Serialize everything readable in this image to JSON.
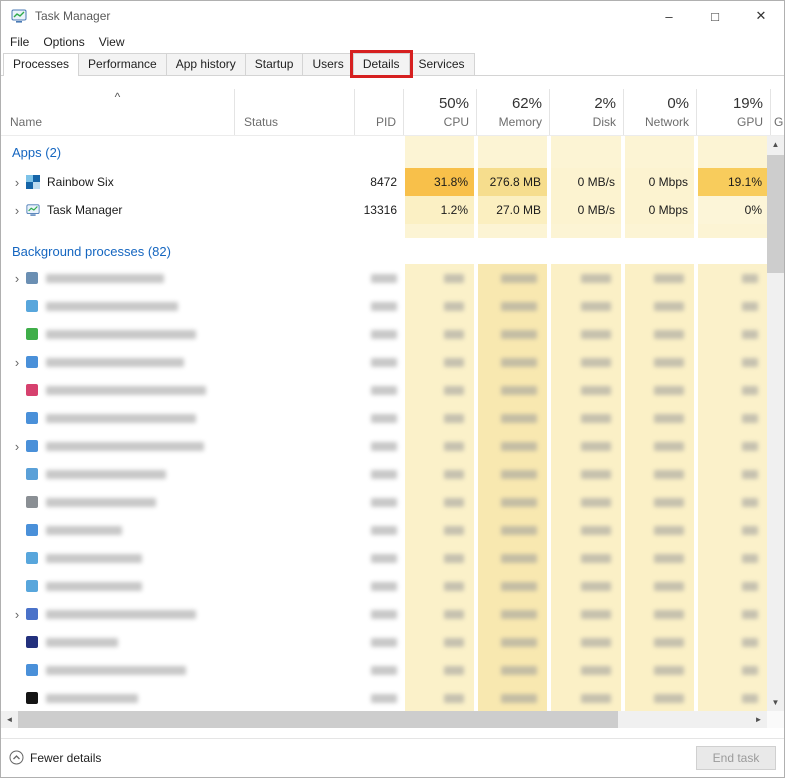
{
  "window": {
    "title": "Task Manager"
  },
  "icons": {
    "minimize": "–",
    "maximize": "□",
    "close": "✕",
    "up": "▲",
    "down": "▼",
    "left": "◄",
    "right": "►",
    "expander": "›",
    "sort_asc": "^"
  },
  "menu": {
    "items": [
      "File",
      "Options",
      "View"
    ]
  },
  "tabs": {
    "items": [
      {
        "label": "Processes",
        "active": true,
        "highlighted": false
      },
      {
        "label": "Performance",
        "active": false,
        "highlighted": false
      },
      {
        "label": "App history",
        "active": false,
        "highlighted": false
      },
      {
        "label": "Startup",
        "active": false,
        "highlighted": false
      },
      {
        "label": "Users",
        "active": false,
        "highlighted": false
      },
      {
        "label": "Details",
        "active": false,
        "highlighted": true
      },
      {
        "label": "Services",
        "active": false,
        "highlighted": false
      }
    ]
  },
  "columns": {
    "name": {
      "label": "Name"
    },
    "status": {
      "label": "Status"
    },
    "pid": {
      "label": "PID"
    },
    "metrics": [
      {
        "label": "CPU",
        "total": "50%"
      },
      {
        "label": "Memory",
        "total": "62%"
      },
      {
        "label": "Disk",
        "total": "2%"
      },
      {
        "label": "Network",
        "total": "0%"
      },
      {
        "label": "GPU",
        "total": "19%"
      }
    ],
    "cut": {
      "label": "G"
    }
  },
  "groups": {
    "apps": "Apps (2)",
    "background": "Background processes (82)"
  },
  "processes": [
    {
      "name": "Rainbow Six",
      "pid": "8472",
      "cpu": "31.8%",
      "memory": "276.8 MB",
      "disk": "0 MB/s",
      "network": "0 Mbps",
      "gpu": "19.1%",
      "heat": {
        "cpu": "#f8c04a",
        "memory": "#f6dd8d",
        "disk": "#fcf3d0",
        "network": "#fcf3d0",
        "gpu": "#f8cc5c"
      }
    },
    {
      "name": "Task Manager",
      "pid": "13316",
      "cpu": "1.2%",
      "memory": "27.0 MB",
      "disk": "0 MB/s",
      "network": "0 Mbps",
      "gpu": "0%",
      "heat": {
        "cpu": "#fbf0c4",
        "memory": "#fbefc0",
        "disk": "#fcf3d0",
        "network": "#fcf3d0",
        "gpu": "#fcf5d8"
      }
    }
  ],
  "heat": {
    "group_cells": "#fcf4d4",
    "background": {
      "cpu": "#fbf1c9",
      "memory": "#f8e8b0",
      "disk": "#fbf0c6",
      "network": "#fbf0c6",
      "gpu": "#fbf1ca"
    }
  },
  "blur_bars": {
    "pid": 26,
    "cpu": 20,
    "memory": 36,
    "disk": 30,
    "network": 30,
    "gpu": 16
  },
  "background_rows": [
    {
      "icon": "#6b8fb3",
      "expander": true,
      "name_w": 118
    },
    {
      "icon": "#58a6dc",
      "expander": false,
      "name_w": 132
    },
    {
      "icon": "#3fae49",
      "expander": false,
      "name_w": 150
    },
    {
      "icon": "#4a90d9",
      "expander": true,
      "name_w": 138
    },
    {
      "icon": "#d6416e",
      "expander": false,
      "name_w": 160
    },
    {
      "icon": "#4a90d9",
      "expander": false,
      "name_w": 150
    },
    {
      "icon": "#4a90d9",
      "expander": true,
      "name_w": 158
    },
    {
      "icon": "#5aa0d8",
      "expander": false,
      "name_w": 120
    },
    {
      "icon": "#8a8f94",
      "expander": false,
      "name_w": 110
    },
    {
      "icon": "#4a90d9",
      "expander": false,
      "name_w": 76
    },
    {
      "icon": "#58a6dc",
      "expander": false,
      "name_w": 96
    },
    {
      "icon": "#58a6dc",
      "expander": false,
      "name_w": 96
    },
    {
      "icon": "#4a72c9",
      "expander": true,
      "name_w": 150
    },
    {
      "icon": "#23307d",
      "expander": false,
      "name_w": 72
    },
    {
      "icon": "#4a90d9",
      "expander": false,
      "name_w": 140
    },
    {
      "icon": "#141414",
      "expander": false,
      "name_w": 92
    }
  ],
  "footer": {
    "fewer_details": "Fewer details",
    "end_task": "End task"
  },
  "colors": {
    "group_text": "#1566c0",
    "highlight_box": "#d62020",
    "heat_high": "#f8c04a",
    "titlebar_text": "#5a5a5a"
  }
}
